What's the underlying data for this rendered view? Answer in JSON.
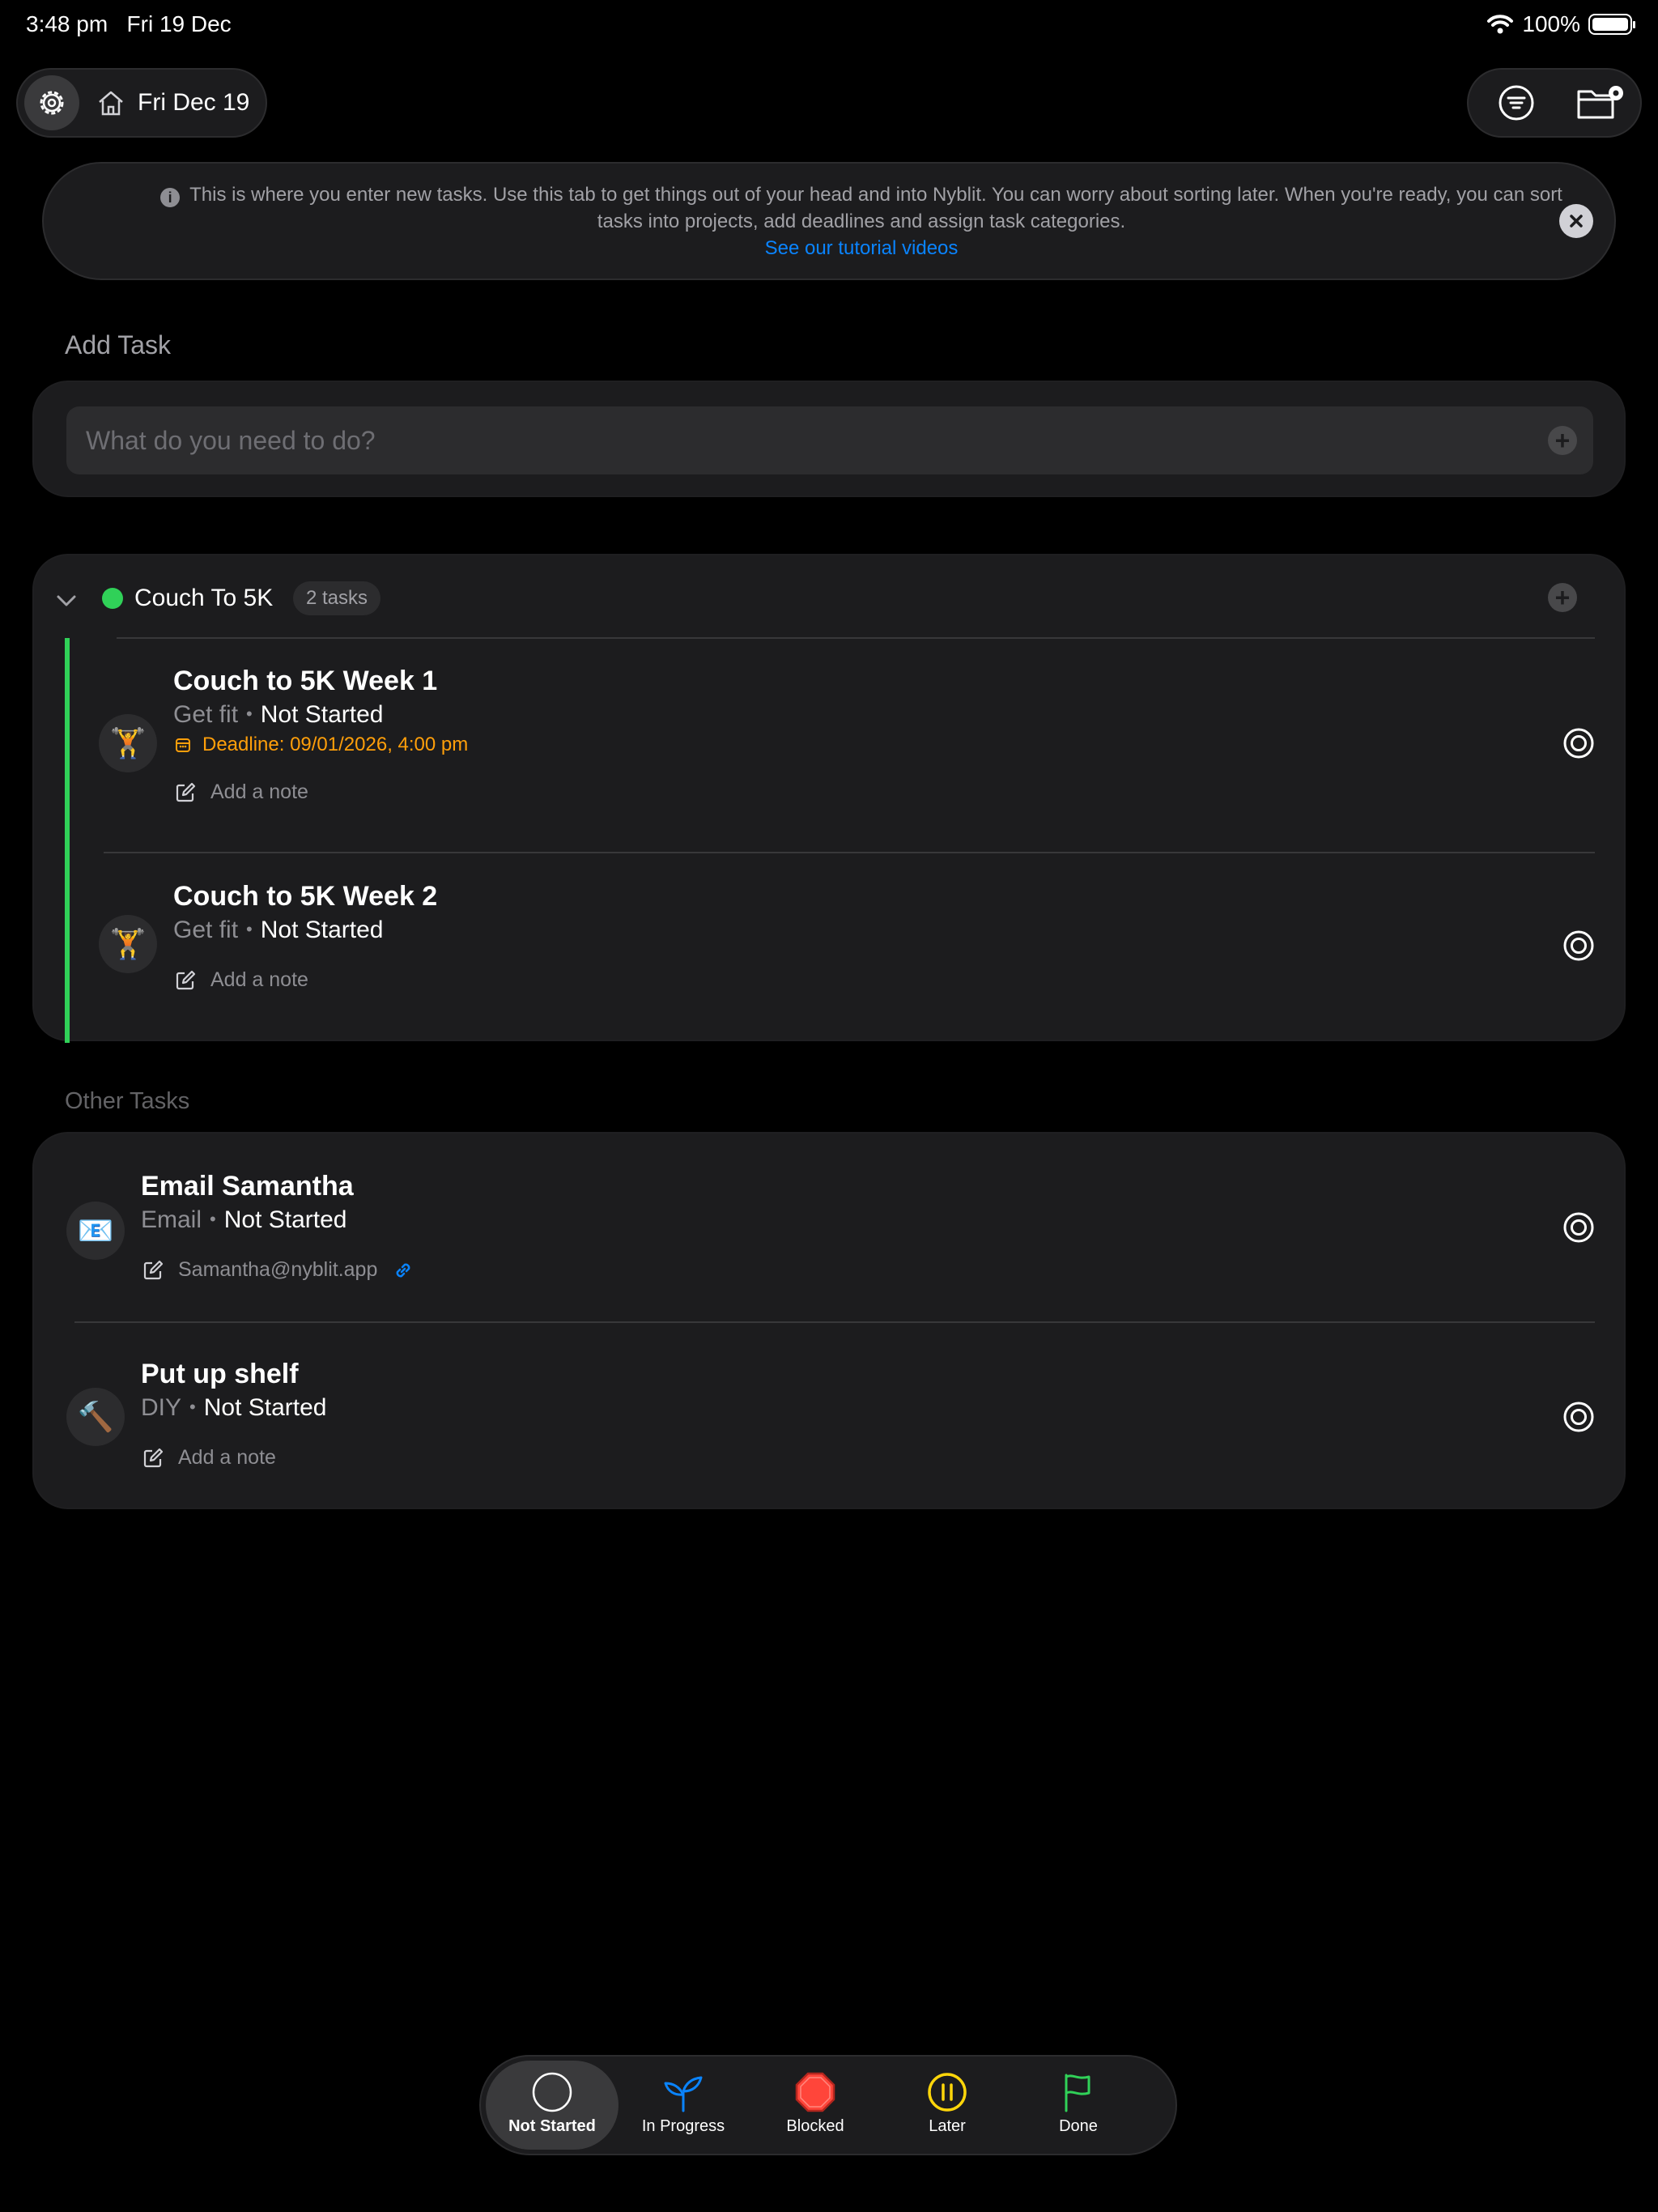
{
  "status_bar": {
    "time": "3:48 pm",
    "date": "Fri 19 Dec",
    "battery": "100%"
  },
  "header": {
    "date_label": "Fri Dec 19"
  },
  "banner": {
    "text": "This is where you enter new tasks. Use this tab to get things out of your head and into Nyblit. You can worry about sorting later. When you're ready, you can sort tasks into projects, add deadlines and assign task categories.",
    "link": "See our tutorial videos"
  },
  "add_task": {
    "title": "Add Task",
    "placeholder": "What do you need to do?"
  },
  "project": {
    "name": "Couch To 5K",
    "count": "2 tasks",
    "color": "#30d158",
    "tasks": [
      {
        "title": "Couch to 5K Week 1",
        "category": "Get fit",
        "status": "Not Started",
        "deadline": "Deadline: 09/01/2026, 4:00 pm",
        "note": "Add a note",
        "icon": "🏋️"
      },
      {
        "title": "Couch to 5K Week 2",
        "category": "Get fit",
        "status": "Not Started",
        "note": "Add a note",
        "icon": "🏋️"
      }
    ]
  },
  "other_tasks": {
    "title": "Other Tasks",
    "tasks": [
      {
        "title": "Email Samantha",
        "category": "Email",
        "status": "Not Started",
        "note": "Samantha@nyblit.app",
        "icon": "📧"
      },
      {
        "title": "Put up shelf",
        "category": "DIY",
        "status": "Not Started",
        "note": "Add a note",
        "icon": "🔨"
      }
    ]
  },
  "tabbar": {
    "tabs": [
      {
        "label": "Not Started",
        "icon": "circle-icon",
        "active": true
      },
      {
        "label": "In Progress",
        "icon": "sprout-icon",
        "color": "#0a84ff"
      },
      {
        "label": "Blocked",
        "icon": "stop-icon",
        "color": "#ff453a"
      },
      {
        "label": "Later",
        "icon": "pause-icon",
        "color": "#ffd60a"
      },
      {
        "label": "Done",
        "icon": "flag-icon",
        "color": "#30d158"
      }
    ]
  }
}
